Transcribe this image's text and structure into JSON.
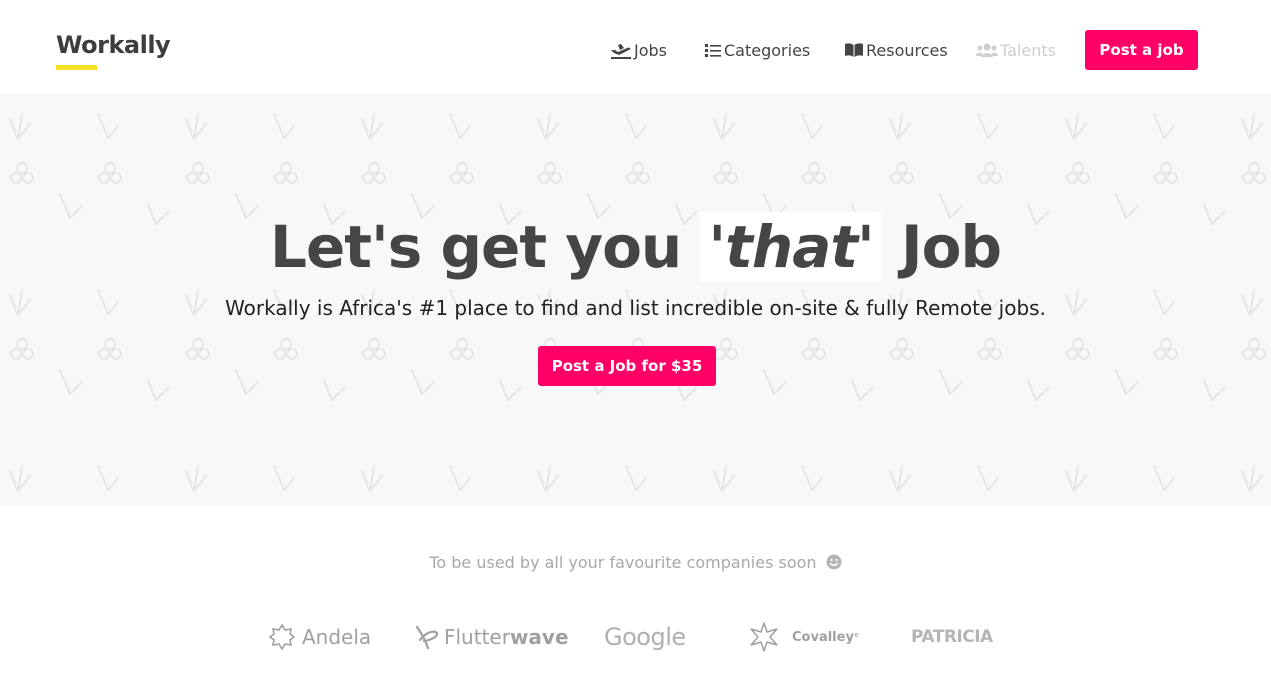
{
  "header": {
    "logo": "Workally",
    "nav": [
      {
        "label": "Jobs",
        "icon": "plane-departure-icon"
      },
      {
        "label": "Categories",
        "icon": "list-icon"
      },
      {
        "label": "Resources",
        "icon": "book-open-icon"
      },
      {
        "label": "Talents",
        "icon": "users-icon",
        "disabled": true
      }
    ],
    "post_button": "Post a job"
  },
  "hero": {
    "title_before": "Let's get you",
    "title_highlight": "'that'",
    "title_after": "Job",
    "subtitle": "Workally is Africa's #1 place to find and list incredible on-site & fully Remote jobs.",
    "cta": "Post a Job for $35"
  },
  "companies": {
    "caption": "To be used by all your favourite companies soon",
    "logos": [
      {
        "name": "Andela"
      },
      {
        "name_light": "Flutter",
        "name_bold": "wave"
      },
      {
        "name": "Google"
      },
      {
        "name": "Covalley",
        "mark": "°"
      },
      {
        "name": "PATRICIA"
      }
    ]
  },
  "colors": {
    "accent": "#ff0066",
    "logo_underline": "#f5e02a",
    "hero_background": "#f8f8f8"
  }
}
